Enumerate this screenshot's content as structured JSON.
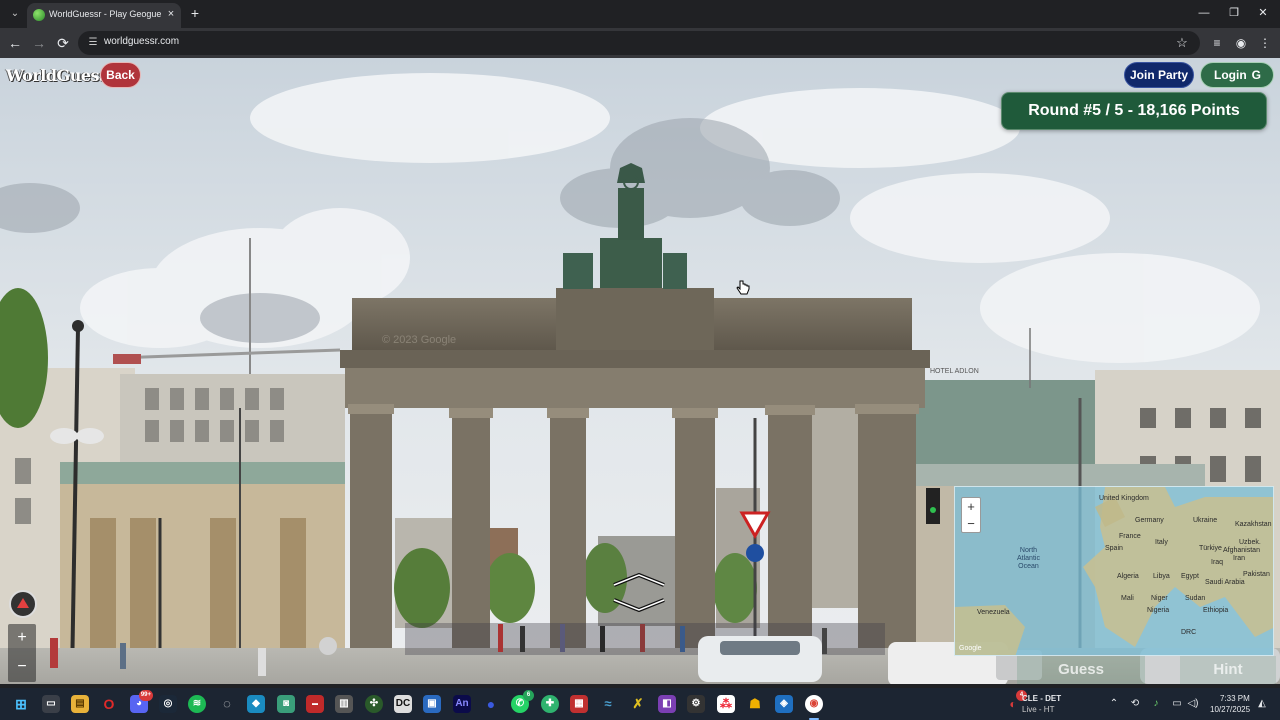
{
  "browser": {
    "tab_title": "WorldGuessr - Play Geoguessr Free",
    "tab_close": "×",
    "new_tab": "+",
    "url": "worldguessr.com",
    "window_controls": {
      "minimize": "—",
      "restore": "❐",
      "close": "✕"
    },
    "nav": {
      "back": "←",
      "forward": "→",
      "reload": "⟳"
    }
  },
  "game": {
    "logo": "WorldGuessr",
    "back_label": "Back",
    "join_party_label": "Join Party",
    "login_label": "Login",
    "login_icon": "G",
    "round_banner": "Round #5 / 5 - 18,166 Points",
    "guess_label": "Guess",
    "hint_label": "Hint",
    "street_watermark": "© 2023 Google",
    "building_sign": "HOTEL ADLON",
    "zoom_in": "+",
    "zoom_out": "−"
  },
  "minimap": {
    "zoom_in": "+",
    "zoom_out": "−",
    "oceans": [
      {
        "name": "North Atlantic Ocean",
        "lines": [
          "North",
          "Atlantic",
          "Ocean"
        ]
      }
    ],
    "countries": [
      "United Kingdom",
      "Germany",
      "Ukraine",
      "Kazakhstan",
      "Spain",
      "France",
      "Italy",
      "Türkiye",
      "Uzbek.",
      "Iraq",
      "Iran",
      "Afghanistan",
      "Algeria",
      "Libya",
      "Egypt",
      "Saudi Arabia",
      "Pakistan",
      "Mali",
      "Niger",
      "Sudan",
      "Nigeria",
      "Ethiopia",
      "Venezuela",
      "DRC",
      "Google"
    ]
  },
  "taskbar": {
    "discord_badge": "99+",
    "whatsapp_badge": "6",
    "sports_badge": "4",
    "sports_line1": "CLE - DET",
    "sports_line2": "Live - HT",
    "time": "7:33 PM",
    "date": "10/27/2025"
  },
  "colors": {
    "back_button": "#b0343b",
    "join_party_button": "#10286b",
    "login_button": "#2e6b48",
    "round_banner": "#1f5a3a"
  }
}
